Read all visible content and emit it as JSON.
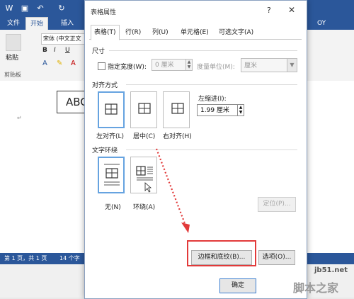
{
  "word": {
    "tabs": [
      "文件",
      "开始",
      "插入"
    ],
    "active_tab": "开始",
    "font_box": "宋体 (中文正文",
    "paste_label": "粘贴",
    "clipboard_label": "剪贴板",
    "doc_text": "ABC",
    "status_page": "第 1 页，共 1 页",
    "status_words": "14 个字",
    "right_user": "OY"
  },
  "dialog": {
    "title": "表格属性",
    "help": "?",
    "close": "✕",
    "tabs": [
      "表格(T)",
      "行(R)",
      "列(U)",
      "单元格(E)",
      "可选文字(A)"
    ],
    "active_tab_index": 0,
    "size": {
      "section": "尺寸",
      "preferred_width_label": "指定宽度(W):",
      "width_value": "0 厘米",
      "unit_label": "度量单位(M):",
      "unit_value": "厘米"
    },
    "alignment": {
      "section": "对齐方式",
      "options": [
        "左对齐(L)",
        "居中(C)",
        "右对齐(H)"
      ],
      "selected": "左对齐(L)",
      "indent_label": "左缩进(I):",
      "indent_value": "1.99 厘米"
    },
    "wrapping": {
      "section": "文字环绕",
      "options": [
        "无(N)",
        "环绕(A)"
      ],
      "selected": "无(N)",
      "positioning_button": "定位(P)..."
    },
    "buttons": {
      "borders": "边框和底纹(B)...",
      "options": "选项(O)...",
      "ok": "确定"
    }
  },
  "watermark": {
    "site": "jb51.net",
    "name": "脚本之家"
  },
  "colors": {
    "word_blue": "#2b579a",
    "highlight_red": "#e23a3a",
    "selection_blue": "#66a3e0"
  }
}
